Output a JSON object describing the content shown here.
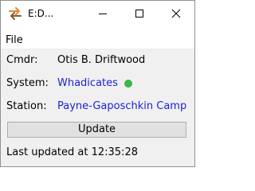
{
  "window": {
    "title": "E:D...",
    "icon": "double-arrow-icon",
    "colors": {
      "icon_accent": "#e08a3a",
      "link": "#1f1fd6",
      "status_ok": "#3ab54a"
    }
  },
  "menu": {
    "file": "File"
  },
  "info": {
    "cmdr_label": "Cmdr:",
    "cmdr_value": "Otis B. Driftwood",
    "system_label": "System:",
    "system_value": "Whadicates",
    "station_label": "Station:",
    "station_value": "Payne-Gaposchkin Camp"
  },
  "actions": {
    "update_label": "Update"
  },
  "status": {
    "last_updated": "Last updated at 12:35:28"
  }
}
